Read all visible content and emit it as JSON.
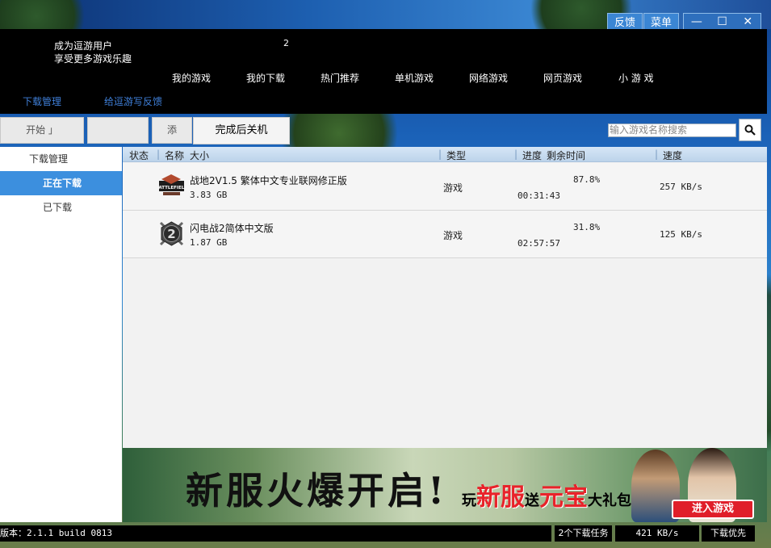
{
  "window": {
    "feedback_label": "反馈",
    "menu_label": "菜单",
    "minimize_glyph": "—",
    "maximize_glyph": "☐",
    "close_glyph": "✕"
  },
  "header": {
    "user_line1": "成为逗游用户",
    "user_line2": "享受更多游戏乐趣",
    "badge_number": "2",
    "nav": [
      {
        "label": "我的游戏"
      },
      {
        "label": "我的下载"
      },
      {
        "label": "热门推荐"
      },
      {
        "label": "单机游戏"
      },
      {
        "label": "网络游戏"
      },
      {
        "label": "网页游戏"
      },
      {
        "label": "小 游 戏"
      }
    ],
    "subnav": [
      {
        "label": "下载管理"
      },
      {
        "label": "给逗游写反馈"
      }
    ]
  },
  "toolbar": {
    "start_label": "开始",
    "pause_label": " ",
    "add_label": "添",
    "shutdown_label": "完成后关机",
    "search_placeholder": "输入游戏名称搜索"
  },
  "sidebar": {
    "title": "下载管理",
    "items": [
      {
        "label": "正在下载",
        "active": true
      },
      {
        "label": "已下载",
        "active": false
      }
    ]
  },
  "list": {
    "columns": {
      "status": "状态",
      "name": "名称",
      "size": "大小",
      "type": "类型",
      "progress": "进度",
      "remaining": "剩余时间",
      "speed": "速度"
    },
    "rows": [
      {
        "icon": "battlefield-icon",
        "name": "战地2V1.5 繁体中文专业联网修正版",
        "size": "3.83 GB",
        "type": "游戏",
        "progress": "87.8%",
        "remaining": "00:31:43",
        "speed": "257 KB/s"
      },
      {
        "icon": "blitzkrieg-icon",
        "name": "闪电战2简体中文版",
        "size": "1.87 GB",
        "type": "游戏",
        "progress": "31.8%",
        "remaining": "02:57:57",
        "speed": "125 KB/s"
      }
    ]
  },
  "banner": {
    "slogan": "新服火爆开启!",
    "promo_prefix": "玩",
    "promo_highlight1": "新服",
    "promo_mid": "送",
    "promo_highlight2": "元宝",
    "promo_suffix": "大礼包",
    "button_label": "进入游戏"
  },
  "status": {
    "version": "版本：2.1.1 build 0813",
    "tasks": "2个下载任务",
    "total_speed": "421 KB/s",
    "priority": "下载优先"
  }
}
